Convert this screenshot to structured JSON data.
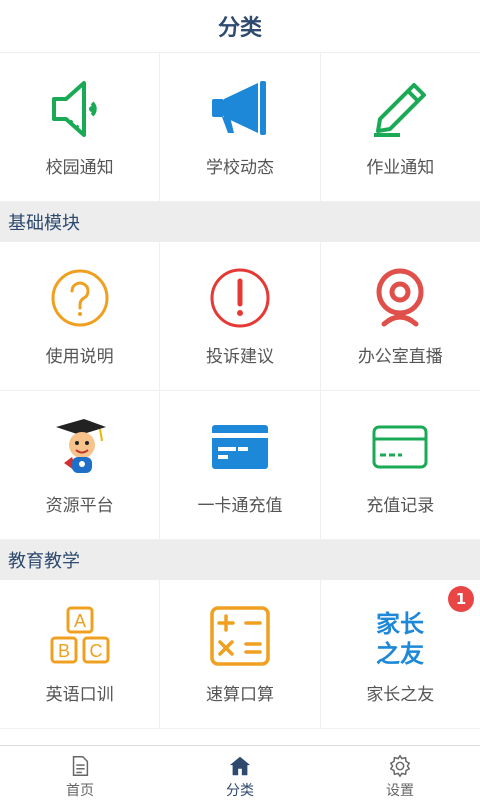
{
  "header": {
    "title": "分类"
  },
  "row1": [
    {
      "label": "校园通知",
      "icon": "speaker-icon"
    },
    {
      "label": "学校动态",
      "icon": "megaphone-icon"
    },
    {
      "label": "作业通知",
      "icon": "pencil-icon"
    }
  ],
  "sections": {
    "basic": "基础模块",
    "education": "教育教学"
  },
  "basic": [
    {
      "label": "使用说明",
      "icon": "question-icon"
    },
    {
      "label": "投诉建议",
      "icon": "exclamation-icon"
    },
    {
      "label": "办公室直播",
      "icon": "webcam-icon"
    },
    {
      "label": "资源平台",
      "icon": "graduate-mascot-icon"
    },
    {
      "label": "一卡通充值",
      "icon": "card-icon"
    },
    {
      "label": "充值记录",
      "icon": "card-record-icon"
    }
  ],
  "education": [
    {
      "label": "英语口训",
      "icon": "abc-blocks-icon"
    },
    {
      "label": "速算口算",
      "icon": "calculator-icon"
    },
    {
      "label": "家长之友",
      "icon": "parents-friend-logo",
      "logo_text": "家长之友",
      "badge": "1"
    }
  ],
  "tabs": [
    {
      "label": "首页",
      "icon": "document-icon"
    },
    {
      "label": "分类",
      "icon": "home-icon",
      "active": true
    },
    {
      "label": "设置",
      "icon": "gear-icon"
    }
  ],
  "colors": {
    "green": "#1aaa55",
    "blue": "#1e88d8",
    "orange": "#f0a020",
    "red": "#e53935",
    "navy": "#2e4a6e",
    "badge": "#e94545"
  }
}
